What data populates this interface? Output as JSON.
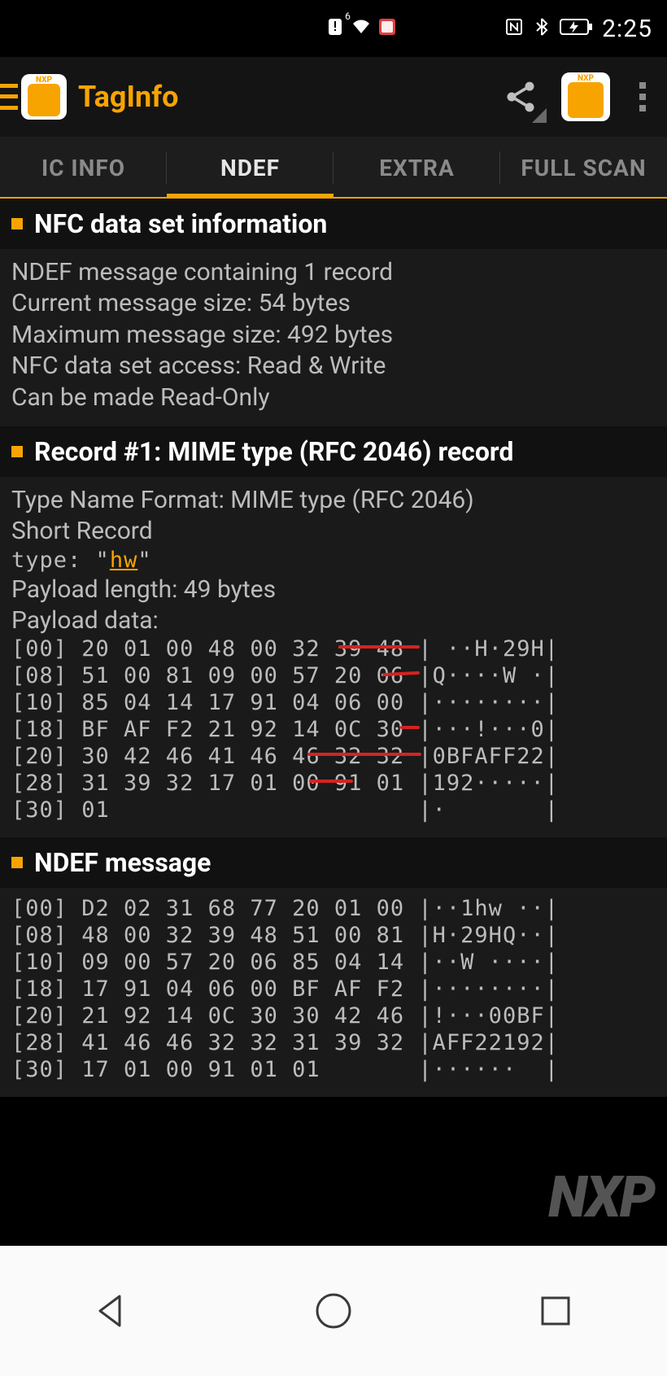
{
  "status": {
    "clock": "2:25"
  },
  "app": {
    "title": "TagInfo",
    "watermark": "NXP"
  },
  "tabs": {
    "ic": "IC INFO",
    "ndef": "NDEF",
    "extra": "EXTRA",
    "full": "FULL SCAN",
    "active": "ndef"
  },
  "sections": {
    "info": {
      "title": "NFC data set information",
      "lines": [
        "NDEF message containing 1 record",
        "Current message size: 54 bytes",
        "Maximum message size: 492 bytes",
        "NFC data set access: Read & Write",
        "Can be made Read-Only"
      ]
    },
    "record": {
      "title": "Record #1: MIME type (RFC 2046) record",
      "tnf": "Type Name Format: MIME type (RFC 2046)",
      "short": "Short Record",
      "type_label": "type: ",
      "type_quote_open": "\"",
      "type_value": "hw",
      "type_quote_close": "\"",
      "payload_len": "Payload length: 49 bytes",
      "payload_data_label": "Payload data:",
      "hex": [
        {
          "off": "[00]",
          "b": "20 01 00 48 00 32 39 48",
          "a": " ··H·29H"
        },
        {
          "off": "[08]",
          "b": "51 00 81 09 00 57 20 06",
          "a": "Q····W ·"
        },
        {
          "off": "[10]",
          "b": "85 04 14 17 91 04 06 00",
          "a": "········"
        },
        {
          "off": "[18]",
          "b": "BF AF F2 21 92 14 0C 30",
          "a": "···!···0"
        },
        {
          "off": "[20]",
          "b": "30 42 46 41 46 46 32 32",
          "a": "0BFAFF22"
        },
        {
          "off": "[28]",
          "b": "31 39 32 17 01 00 91 01",
          "a": "192·····"
        },
        {
          "off": "[30]",
          "b": "01                     ",
          "a": "·       "
        }
      ]
    },
    "msg": {
      "title": "NDEF message",
      "hex": [
        {
          "off": "[00]",
          "b": "D2 02 31 68 77 20 01 00",
          "a": "··1hw ··"
        },
        {
          "off": "[08]",
          "b": "48 00 32 39 48 51 00 81",
          "a": "H·29HQ··"
        },
        {
          "off": "[10]",
          "b": "09 00 57 20 06 85 04 14",
          "a": "··W ····"
        },
        {
          "off": "[18]",
          "b": "17 91 04 06 00 BF AF F2",
          "a": "········"
        },
        {
          "off": "[20]",
          "b": "21 92 14 0C 30 30 42 46",
          "a": "!···00BF"
        },
        {
          "off": "[28]",
          "b": "41 46 46 32 32 31 39 32",
          "a": "AFF22192"
        },
        {
          "off": "[30]",
          "b": "17 01 00 91 01 01      ",
          "a": "······  "
        }
      ]
    }
  }
}
